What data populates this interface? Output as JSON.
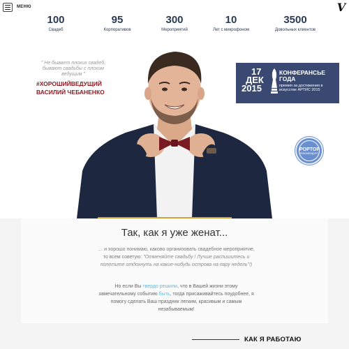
{
  "topbar": {
    "menu_label": "МЕНЮ",
    "logo_glyph": "V"
  },
  "stats": [
    {
      "num": "100",
      "label": "Свадеб"
    },
    {
      "num": "95",
      "label": "Корпоративов"
    },
    {
      "num": "300",
      "label": "Мероприятий"
    },
    {
      "num": "10",
      "label": "Лет с микрофоном"
    },
    {
      "num": "3500",
      "label": "Довольных клиентов"
    }
  ],
  "intro": {
    "quote": "\" Не бывает плохих свадеб, бывают свадьбы с плохим ведущим \"",
    "hashtag": "#ХОРОШИЙВЕДУЩИЙ",
    "name": "ВАСИЛИЙ ЧЕБАНЕНКО"
  },
  "award": {
    "day": "17",
    "month": "ДЕК",
    "year": "2015",
    "title_line1": "КОНФЕРАНСЬЕ",
    "title_line2": "ГОДА",
    "subtitle": "премия за достижения в искусстве АРТИС 2015"
  },
  "badge": {
    "title": "POPTOP",
    "subtitle": "РЕКОМЕНДУЕТ"
  },
  "content": {
    "heading": "Так, как я уже женат...",
    "p1_text": "… и хорошо понимаю, каково организовать свадебное мероприятие, то всем советую:",
    "p1_quote": "\"Отменяйте свадьбу ! Лучше распишитесь и полетите отдохнуть на какие-нибудь острова на пару недель\"!)",
    "p2_a": "Но если Вы ",
    "p2_hl1": "твердо решили",
    "p2_b": ", что в Вашей жизни этому замечательному событию ",
    "p2_hl2": "быть",
    "p2_c": ", тогда присаживайтесь поудобнее, я помогу сделать Ваш праздник легким, красивым и самым незабываемым!",
    "section_title": "КАК Я РАБОТАЮ"
  },
  "colors": {
    "accent_red": "#8c1c22",
    "award_blue": "#394971",
    "link": "#5fb9d8",
    "gold": "#d2a332"
  }
}
